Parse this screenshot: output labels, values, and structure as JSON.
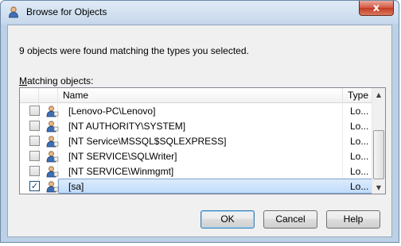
{
  "window": {
    "title": "Browse for Objects",
    "close_symbol": "x",
    "icon": "user-icon"
  },
  "status_text": "9 objects were found matching the types you selected.",
  "matching_label_accel": "M",
  "matching_label_rest": "atching objects:",
  "list": {
    "headers": {
      "name": "Name",
      "type": "Type"
    },
    "rows": [
      {
        "name": "[Lenovo-PC\\Lenovo]",
        "type": "Lo...",
        "checked": false,
        "selected": false
      },
      {
        "name": "[NT AUTHORITY\\SYSTEM]",
        "type": "Lo...",
        "checked": false,
        "selected": false
      },
      {
        "name": "[NT Service\\MSSQL$SQLEXPRESS]",
        "type": "Lo...",
        "checked": false,
        "selected": false
      },
      {
        "name": "[NT SERVICE\\SQLWriter]",
        "type": "Lo...",
        "checked": false,
        "selected": false
      },
      {
        "name": "[NT SERVICE\\Winmgmt]",
        "type": "Lo...",
        "checked": false,
        "selected": false
      },
      {
        "name": "[sa]",
        "type": "Lo...",
        "checked": true,
        "selected": true
      }
    ],
    "scrollbar": {
      "up_glyph": "▲",
      "down_glyph": "▼"
    }
  },
  "buttons": {
    "ok": "OK",
    "cancel": "Cancel",
    "help": "Help"
  },
  "colors": {
    "selection": "#cce8ff",
    "close_button": "#c43a23",
    "title_gradient": "#c8d9ec"
  }
}
